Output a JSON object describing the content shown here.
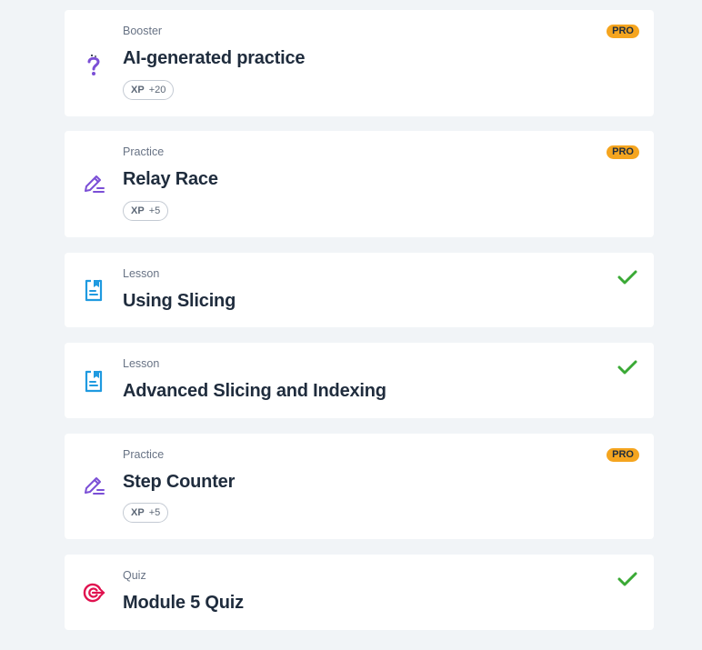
{
  "items": [
    {
      "type": "Booster",
      "title": "AI-generated practice",
      "icon": "question-sparkle-icon",
      "xp_label": "XP",
      "xp_value": "+20",
      "badge": "PRO",
      "completed": false
    },
    {
      "type": "Practice",
      "title": "Relay Race",
      "icon": "pencil-edit-icon",
      "xp_label": "XP",
      "xp_value": "+5",
      "badge": "PRO",
      "completed": false
    },
    {
      "type": "Lesson",
      "title": "Using Slicing",
      "icon": "lesson-document-icon",
      "completed": true
    },
    {
      "type": "Lesson",
      "title": "Advanced Slicing and Indexing",
      "icon": "lesson-document-icon",
      "completed": true
    },
    {
      "type": "Practice",
      "title": "Step Counter",
      "icon": "pencil-edit-icon",
      "xp_label": "XP",
      "xp_value": "+5",
      "badge": "PRO",
      "completed": false
    },
    {
      "type": "Quiz",
      "title": "Module 5 Quiz",
      "icon": "target-quiz-icon",
      "completed": true
    }
  ],
  "colors": {
    "background": "#f1f4f7",
    "pro_badge": "#f5a51f",
    "check": "#3aa935",
    "practice_icon": "#7b4fd6",
    "lesson_icon": "#1f9ae0",
    "quiz_icon": "#e0124f"
  }
}
